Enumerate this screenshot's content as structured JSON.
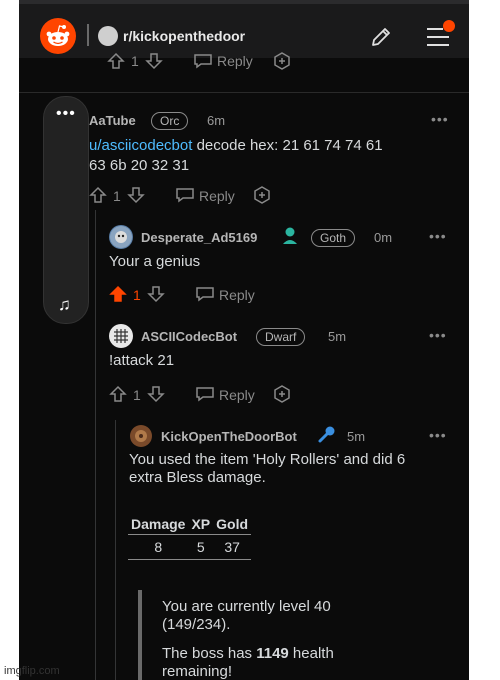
{
  "header": {
    "subreddit": "r/kickopenthedoor",
    "colors": {
      "brand": "#ff4500",
      "link": "#4fbcff",
      "upvoted": "#ff4500"
    }
  },
  "previous_comment": {
    "reply_label": "Reply",
    "votes": "1"
  },
  "comments": [
    {
      "author": "AaTube",
      "flair": "Orc",
      "time": "6m",
      "mention": "u/asciicodecbot",
      "text_a": " decode hex: 21 61 74 74 61",
      "text_b": "63 6b 20 32 31",
      "votes": "1",
      "reply_label": "Reply"
    },
    {
      "author": "Desperate_Ad5169",
      "flair": "Goth",
      "time": "0m",
      "text": "Your a genius",
      "votes": "1",
      "reply_label": "Reply"
    },
    {
      "author": "ASCIICodecBot",
      "flair": "Dwarf",
      "time": "5m",
      "text": "!attack 21",
      "votes": "1",
      "reply_label": "Reply"
    },
    {
      "author": "KickOpenTheDoorBot",
      "time": "5m",
      "text_a": "You used the item 'Holy Rollers' and did 6",
      "text_b": "extra Bless damage.",
      "table": {
        "headers": [
          "Damage",
          "XP",
          "Gold"
        ],
        "rows": [
          [
            "8",
            "5",
            "37"
          ]
        ]
      },
      "quote_a1": "You are currently level 40",
      "quote_a2": "(149/234).",
      "quote_b_prefix": "The boss has ",
      "quote_b_bold": "1149",
      "quote_b_suffix": " health",
      "quote_b2": "remaining!"
    }
  ],
  "watermark": "imgflip.com"
}
